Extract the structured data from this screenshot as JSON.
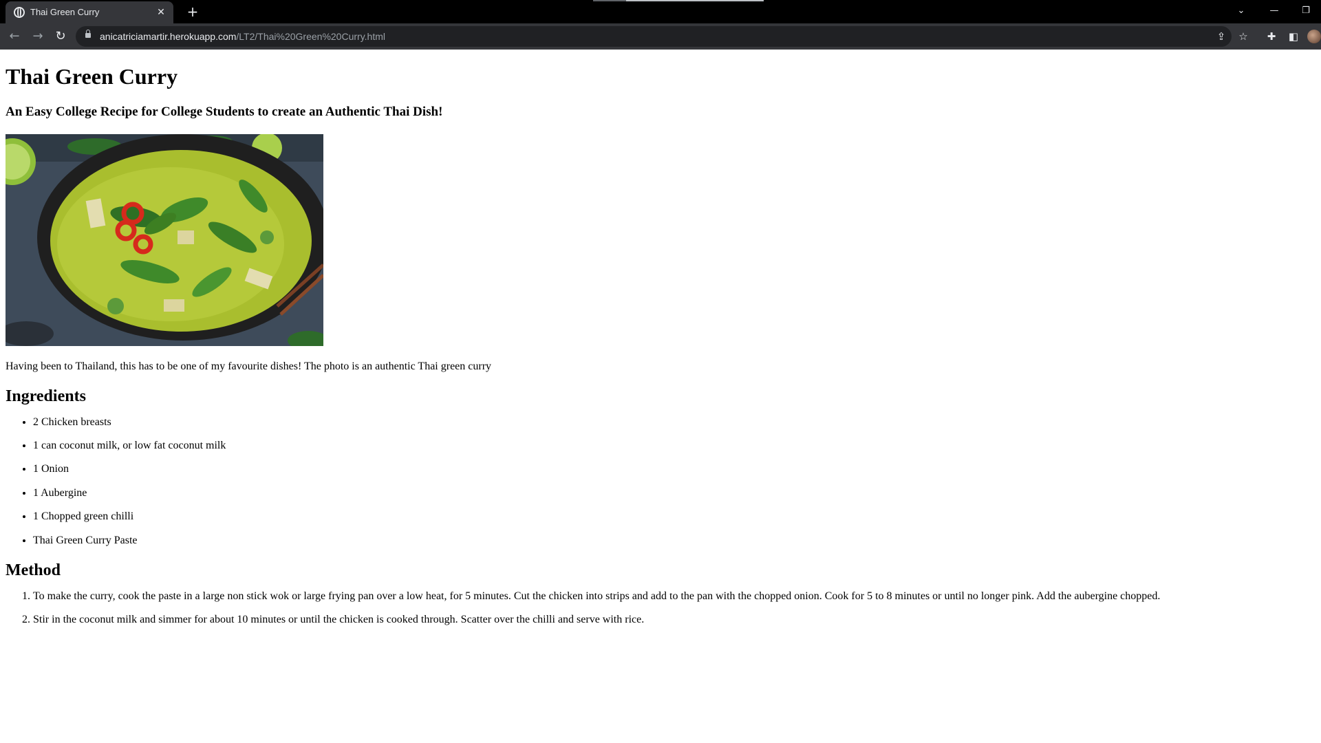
{
  "browser": {
    "tab_title": "Thai Green Curry",
    "url_host": "anicatriciamartir.herokuapp.com",
    "url_path": "/LT2/Thai%20Green%20Curry.html",
    "icons": {
      "tab_close": "close-icon",
      "new_tab": "plus-icon",
      "back": "back-arrow-icon",
      "forward": "forward-arrow-icon",
      "reload": "reload-icon",
      "lock": "lock-icon",
      "share": "share-icon",
      "bookmark": "star-icon",
      "extensions": "puzzle-icon",
      "side_panel": "side-panel-icon",
      "tab_search": "chevron-down-icon",
      "minimize": "minimize-icon",
      "restore": "restore-icon"
    }
  },
  "page": {
    "title": "Thai Green Curry",
    "subtitle": "An Easy College Recipe for College Students to create an Authentic Thai Dish!",
    "caption": "Having been to Thailand, this has to be one of my favourite dishes! The photo is an authentic Thai green curry",
    "ingredients_heading": "Ingredients",
    "ingredients": [
      "2 Chicken breasts",
      "1 can coconut milk, or low fat coconut milk",
      "1 Onion",
      "1 Aubergine",
      "1 Chopped green chilli",
      "Thai Green Curry Paste"
    ],
    "method_heading": "Method",
    "method": [
      "To make the curry, cook the paste in a large non stick wok or large frying pan over a low heat, for 5 minutes. Cut the chicken into strips and add to the pan with the chopped onion. Cook for 5 to 8 minutes or until no longer pink. Add the aubergine chopped.",
      "Stir in the coconut milk and simmer for about 10 minutes or until the chicken is cooked through. Scatter over the chilli and serve with rice."
    ]
  },
  "colors": {
    "tab_bg": "#35363a",
    "omnibox_bg": "#202124",
    "frame_bg": "#000000",
    "curry_green": "#b5c93a",
    "chilli_red": "#d62a1c",
    "pan_dark": "#1f1f1f",
    "table_blue": "#3e4b5a"
  }
}
